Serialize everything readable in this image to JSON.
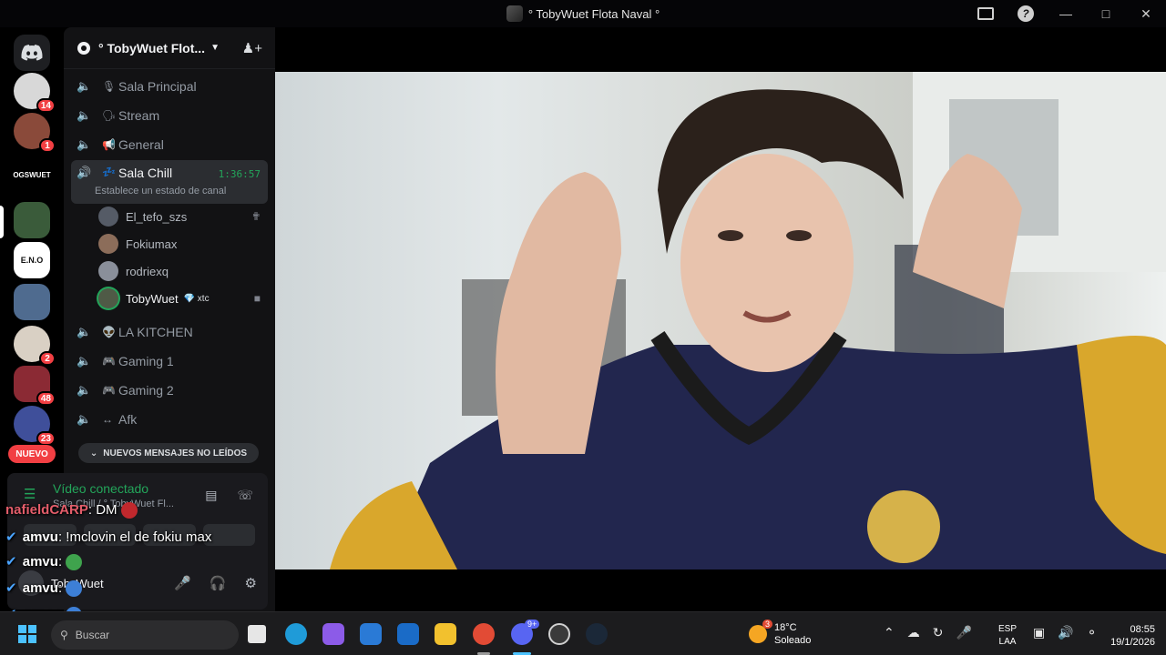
{
  "window": {
    "title": "° TobyWuet Flota Naval °",
    "help_icon": "?",
    "minimize": "—",
    "maximize": "□",
    "close": "✕"
  },
  "rail": {
    "servers": [
      {
        "badge": "14",
        "color": "#d8d8d8"
      },
      {
        "badge": "1",
        "color": "#8a4a3a"
      },
      {
        "label": "OGSWUET",
        "color": "#000000"
      },
      {
        "badge": "",
        "color": "#3a5b3a"
      },
      {
        "label": "E.N.O",
        "color": "#ffffff"
      },
      {
        "badge": "",
        "color": "#4f6b8f"
      },
      {
        "badge": "2",
        "color": "#d9d0c4"
      },
      {
        "badge": "48",
        "color": "#8b2a34"
      },
      {
        "badge": "23",
        "color": "#3f4f9a"
      }
    ],
    "nuevo": "NUEVO"
  },
  "guild": {
    "name": "° TobyWuet Flot...",
    "channels": [
      {
        "name": "Sala Principal",
        "emoji": "🎙"
      },
      {
        "name": "Stream",
        "emoji": "🗣"
      },
      {
        "name": "General",
        "emoji": "📢"
      },
      {
        "name": "Sala Chill",
        "emoji": "💤",
        "timer": "1:36:57",
        "status": "Establece un estado de canal"
      },
      {
        "name": "LA KITCHEN",
        "emoji": "👽"
      },
      {
        "name": "Gaming 1",
        "emoji": "🎮"
      },
      {
        "name": "Gaming 2",
        "emoji": "🎮"
      },
      {
        "name": "Afk",
        "emoji": "↔"
      }
    ],
    "members": [
      {
        "name": "El_tefo_szs",
        "color": "#555b66"
      },
      {
        "name": "Fokiumax",
        "color": "#8c6d5a"
      },
      {
        "name": "rodriexq",
        "color": "#8a8f9a"
      },
      {
        "name": "TobyWuet",
        "tag": "💎 xtc",
        "color": "#4f5a46"
      }
    ],
    "new_messages": "NUEVOS MENSAJES NO LEÍDOS"
  },
  "voice": {
    "status": "Vídeo conectado",
    "sub": "Sala Chill / ° TobyWuet Fl...",
    "user": "TobyWuet"
  },
  "chat": [
    {
      "nick": "nafieldCARP",
      "text": "DM",
      "verified": false,
      "emote": "#c0282d"
    },
    {
      "nick": "amvu",
      "text": "!mclovin el de fokiu max",
      "verified": true
    },
    {
      "nick": "amvu",
      "text": "",
      "verified": true,
      "emote": "#3fa34d"
    },
    {
      "nick": "amvu",
      "text": "",
      "verified": true,
      "emote": "#3d7fd6"
    },
    {
      "nick": "amvu",
      "text": "",
      "verified": true,
      "emote": "#3d7fd6"
    },
    {
      "nick": "amvu",
      "text": "",
      "verified": true,
      "emote": "#3d7fd6"
    }
  ],
  "taskbar": {
    "search_placeholder": "Buscar",
    "weather_temp": "18°C",
    "weather_desc": "Soleado",
    "weather_badge": "3",
    "discord_badge": "9+",
    "lang_top": "ESP",
    "lang_bottom": "LAA",
    "time": "08:55",
    "date": "19/1/2026"
  },
  "colors": {
    "online_green": "#23a55a",
    "badge_red": "#f23f43",
    "blurple": "#5865f2"
  }
}
